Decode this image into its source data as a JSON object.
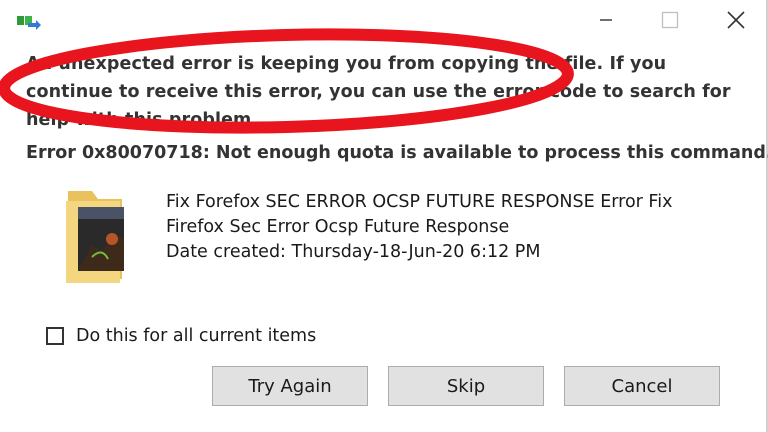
{
  "titlebar": {
    "app_icon": "copy-progress-icon",
    "minimize_icon": "minimize-icon",
    "maximize_icon": "maximize-icon",
    "close_icon": "close-icon"
  },
  "message": {
    "main": "An unexpected error is keeping you from copying the file. If you continue to receive this error, you can use the error code to search for help with this problem.",
    "error": "Error 0x80070718: Not enough quota is available to process this command."
  },
  "file": {
    "icon": "folder-thumbnail-icon",
    "name": "Fix Forefox SEC ERROR OCSP FUTURE RESPONSE Error  Fix Firefox Sec Error Ocsp Future Response",
    "date": "Date created: Thursday-18-Jun-20 6:12 PM"
  },
  "checkbox": {
    "label": "Do this for all current items",
    "checked": false
  },
  "buttons": {
    "try_again": "Try Again",
    "skip": "Skip",
    "cancel": "Cancel"
  },
  "colors": {
    "annotation": "#e8141e",
    "button_face": "#e1e1e1",
    "folder": "#f1d27a"
  }
}
